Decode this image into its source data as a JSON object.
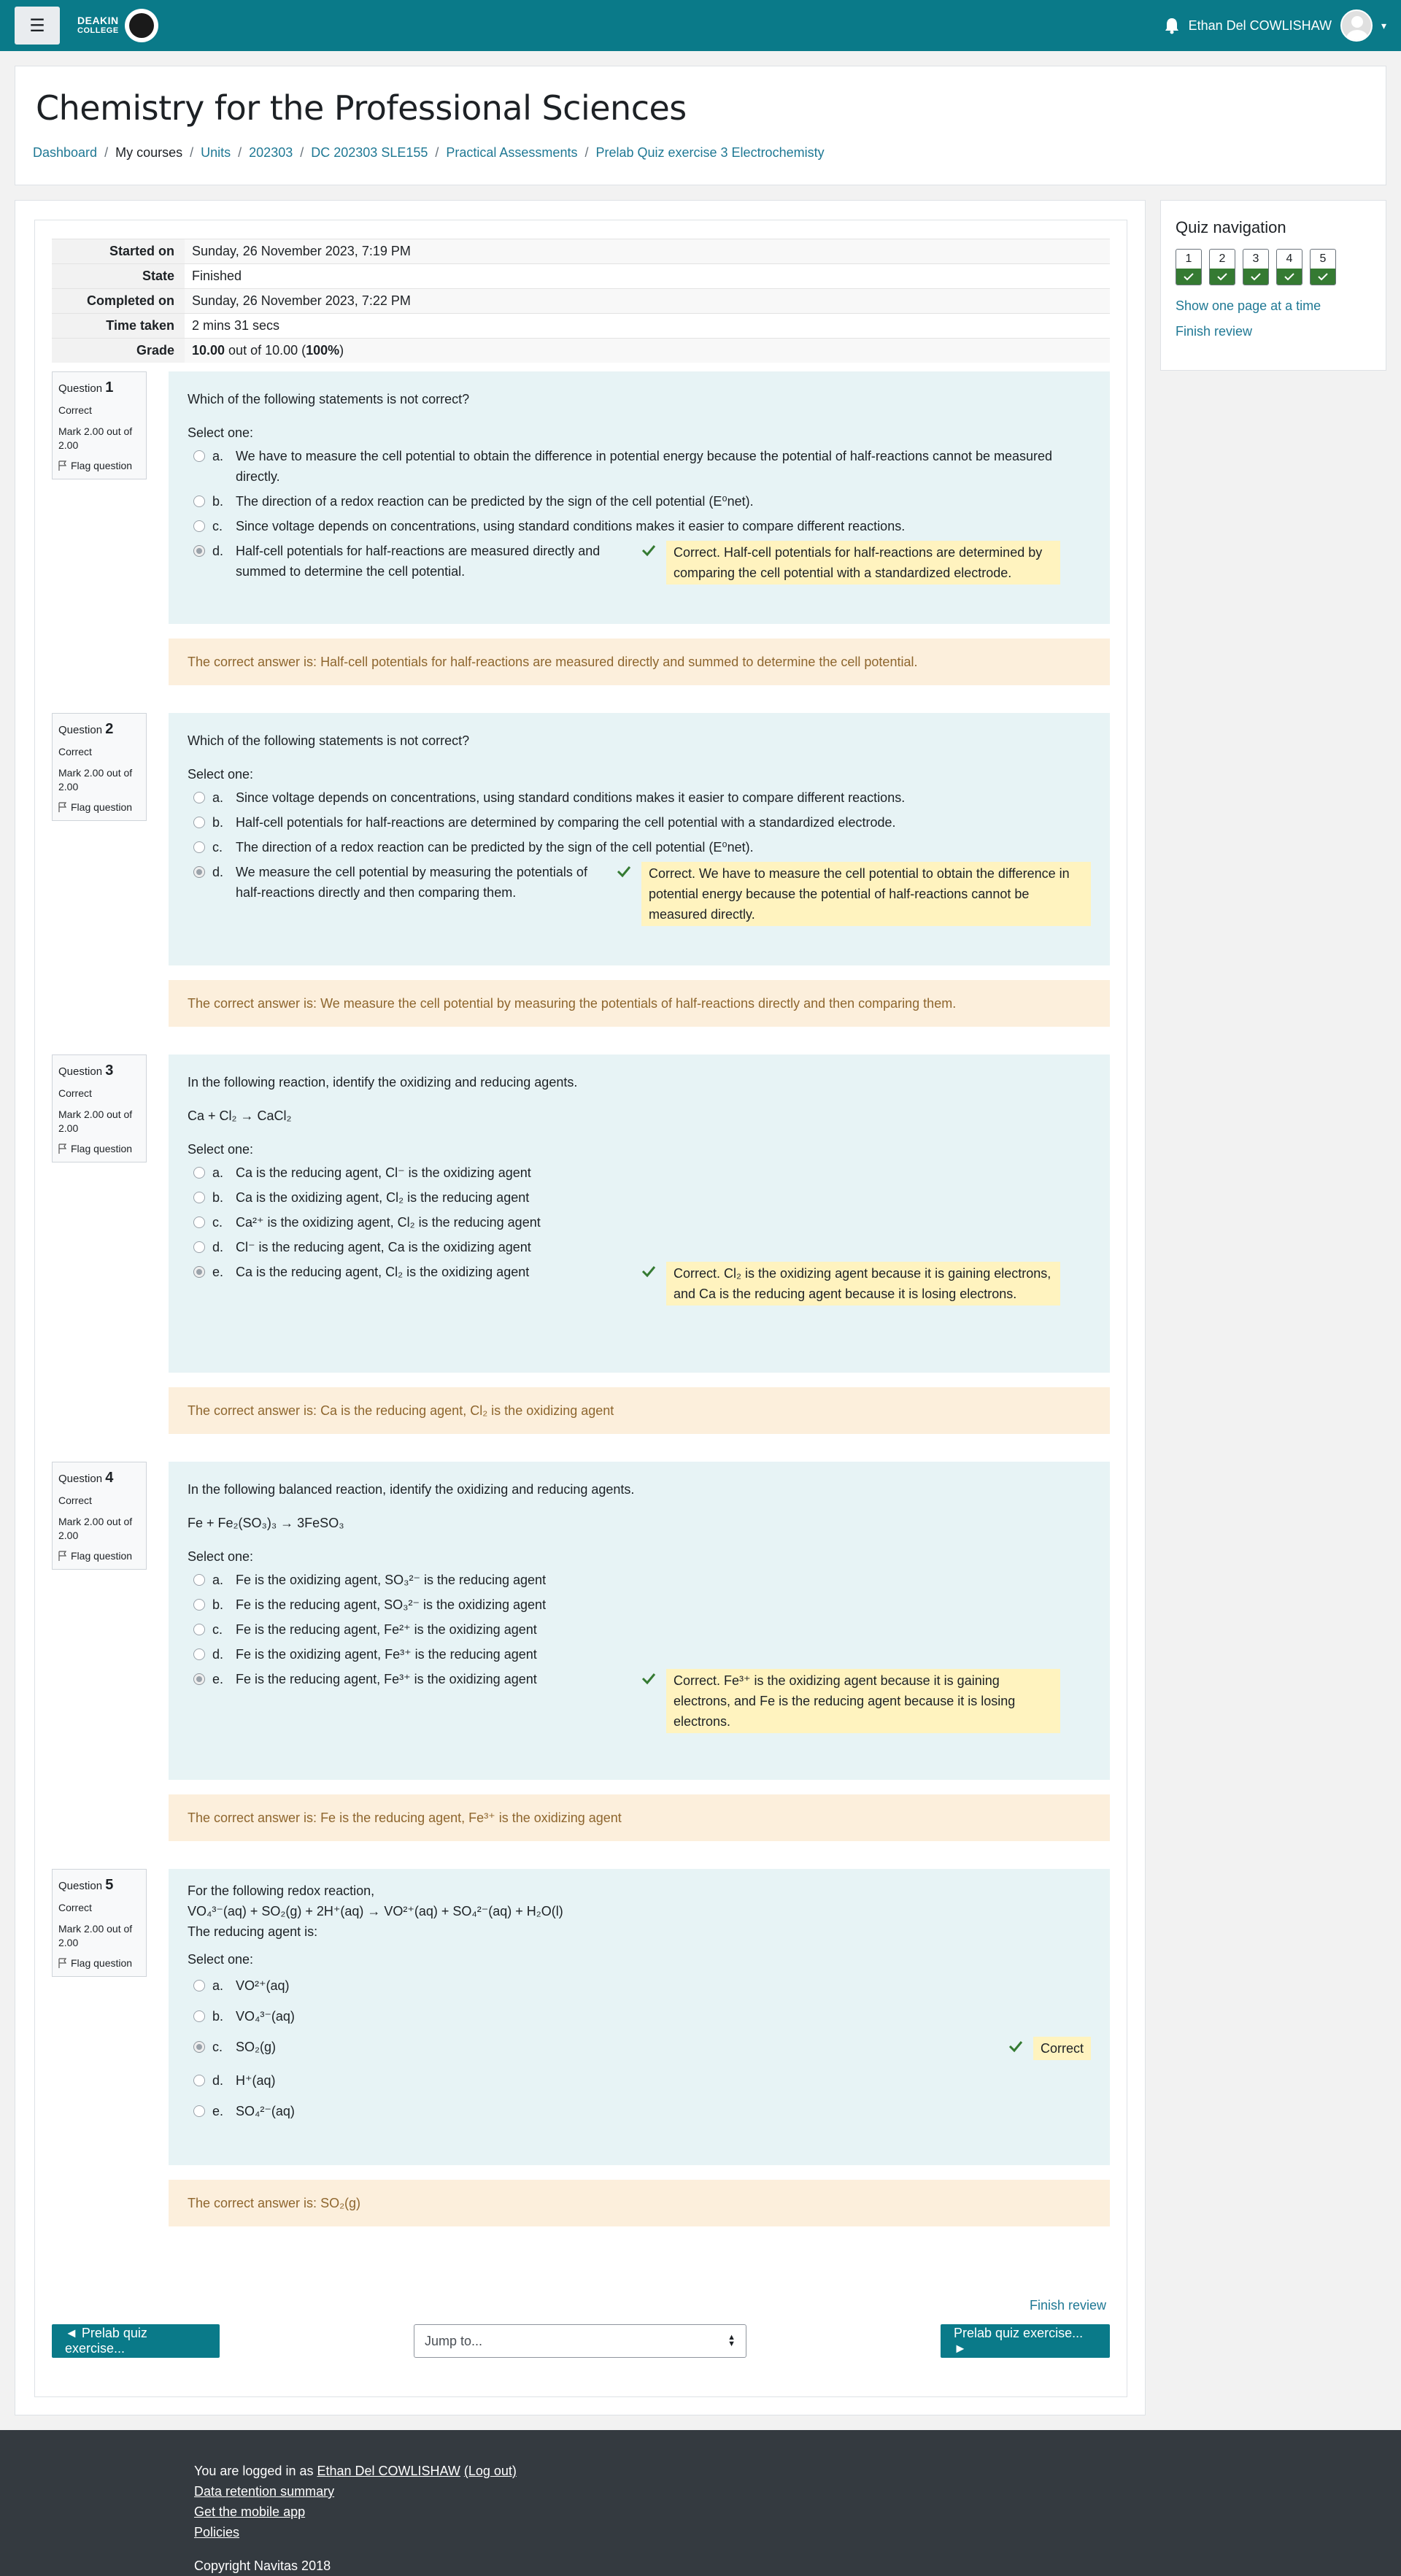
{
  "navbar": {
    "logo_text_line1": "DEAKIN",
    "logo_text_line2": "COLLEGE",
    "user_name": "Ethan Del COWLISHAW",
    "caret": "▾",
    "menu_icon": "☰"
  },
  "header": {
    "title": "Chemistry for the Professional Sciences",
    "breadcrumb": [
      "Dashboard",
      "My courses",
      "Units",
      "202303",
      "DC 202303 SLE155",
      "Practical Assessments",
      "Prelab Quiz exercise 3 Electrochemisty"
    ]
  },
  "summary": {
    "started_label": "Started on",
    "started": "Sunday, 26 November 2023, 7:19 PM",
    "state_label": "State",
    "state": "Finished",
    "completed_label": "Completed on",
    "completed": "Sunday, 26 November 2023, 7:22 PM",
    "time_label": "Time taken",
    "time": "2 mins 31 secs",
    "grade_label": "Grade",
    "grade_score": "10.00",
    "grade_mid": " out of 10.00 (",
    "grade_pct": "100%",
    "grade_end": ")"
  },
  "question_common": {
    "question_word": "Question",
    "status": "Correct",
    "mark": "Mark 2.00 out of 2.00",
    "flag": "Flag question",
    "select_one": "Select one:",
    "correct_answer_prefix": "The correct answer is: "
  },
  "questions": [
    {
      "number": "1"
    },
    {
      "number": "2"
    },
    {
      "number": "3"
    },
    {
      "number": "4"
    },
    {
      "number": "5"
    }
  ],
  "q1": {
    "text": "Which of the following statements is not correct?",
    "options": [
      {
        "letter": "a.",
        "text": "We have to measure the cell potential to obtain the difference in potential energy because the potential of half-reactions cannot be measured directly."
      },
      {
        "letter": "b.",
        "text": "The direction of a redox reaction can be predicted by the sign of the cell potential (E⁰net)."
      },
      {
        "letter": "c.",
        "text": "Since voltage depends on concentrations, using standard conditions makes it easier to compare different reactions."
      },
      {
        "letter": "d.",
        "text": "Half-cell potentials for half-reactions are measured directly and summed to determine the cell potential."
      }
    ],
    "feedback": "Correct. Half-cell potentials for half-reactions are determined by comparing the cell potential with a standardized electrode.",
    "right_answer": "Half-cell potentials for half-reactions are measured directly and summed to determine the cell potential."
  },
  "q2": {
    "text": "Which of the following statements is not correct?",
    "options": [
      {
        "letter": "a.",
        "text": "Since voltage depends on concentrations, using standard conditions makes it easier to compare different reactions."
      },
      {
        "letter": "b.",
        "text": "Half-cell potentials for half-reactions are determined by comparing the cell potential with a standardized electrode."
      },
      {
        "letter": "c.",
        "text": "The direction of a redox reaction can be predicted by the sign of the cell potential (E⁰net)."
      },
      {
        "letter": "d.",
        "text": "We measure the cell potential by measuring the potentials of half-reactions directly and then comparing them."
      }
    ],
    "feedback": "Correct. We have to measure the cell potential to obtain the difference in potential energy because the potential of half-reactions cannot be measured directly.",
    "right_answer": "We measure the cell potential by measuring the potentials of half-reactions directly and then comparing them."
  },
  "q3": {
    "text": "In the following reaction, identify the oxidizing and reducing agents.",
    "reaction": "Ca + Cl₂ → CaCl₂",
    "options": [
      {
        "letter": "a.",
        "text": "Ca is the reducing agent, Cl⁻ is the oxidizing agent"
      },
      {
        "letter": "b.",
        "text": "Ca is the oxidizing agent, Cl₂ is the reducing agent"
      },
      {
        "letter": "c.",
        "text": "Ca²⁺ is the oxidizing agent, Cl₂ is the reducing agent"
      },
      {
        "letter": "d.",
        "text": "Cl⁻ is the reducing agent, Ca is the oxidizing agent"
      },
      {
        "letter": "e.",
        "text": "Ca is the reducing agent, Cl₂ is the oxidizing agent"
      }
    ],
    "feedback": "Correct. Cl₂ is the oxidizing agent because it is gaining electrons, and Ca is the reducing agent because it is losing electrons.",
    "right_answer": "Ca is the reducing agent, Cl₂ is the oxidizing agent"
  },
  "q4": {
    "text": "In the following balanced reaction, identify the oxidizing and reducing agents.",
    "reaction": "Fe + Fe₂(SO₃)₃ → 3FeSO₃",
    "options": [
      {
        "letter": "a.",
        "text": "Fe is the oxidizing agent, SO₃²⁻ is the reducing agent"
      },
      {
        "letter": "b.",
        "text": "Fe is the reducing agent, SO₃²⁻ is the oxidizing agent"
      },
      {
        "letter": "c.",
        "text": "Fe is the reducing agent, Fe²⁺ is the oxidizing agent"
      },
      {
        "letter": "d.",
        "text": "Fe is the oxidizing agent, Fe³⁺ is the reducing agent"
      },
      {
        "letter": "e.",
        "text": "Fe is the reducing agent, Fe³⁺ is the oxidizing agent"
      }
    ],
    "feedback": "Correct. Fe³⁺ is the oxidizing agent because it is gaining electrons, and Fe is the reducing agent because it is losing electrons.",
    "right_answer": "Fe is the reducing agent, Fe³⁺ is the oxidizing agent"
  },
  "q5": {
    "text_line1": "For the following redox reaction,",
    "reaction": "VO₄³⁻(aq) + SO₂(g) + 2H⁺(aq) → VO²⁺(aq) + SO₄²⁻(aq) + H₂O(l)",
    "text_line3": "The reducing agent is:",
    "options": [
      {
        "letter": "a.",
        "text": "VO²⁺(aq)"
      },
      {
        "letter": "b.",
        "text": "VO₄³⁻(aq)"
      },
      {
        "letter": "c.",
        "text": "SO₂(g)"
      },
      {
        "letter": "d.",
        "text": "H⁺(aq)"
      },
      {
        "letter": "e.",
        "text": "SO₄²⁻(aq)"
      }
    ],
    "feedback": "Correct",
    "right_answer": "SO₂(g)"
  },
  "bottom_nav": {
    "finish_review": "Finish review",
    "prev_label": "◄ Prelab quiz exercise...",
    "jump_placeholder": "Jump to...",
    "next_label": "Prelab quiz exercise... ►"
  },
  "quiz_nav": {
    "title": "Quiz navigation",
    "buttons": [
      "1",
      "2",
      "3",
      "4",
      "5"
    ],
    "show_one_page": "Show one page at a time",
    "finish_review": "Finish review"
  },
  "footer": {
    "logged_in_prefix": "You are logged in as ",
    "user_name": "Ethan Del COWLISHAW",
    "logout": "(Log out)",
    "data_retention": "Data retention summary",
    "mobile_app": "Get the mobile app",
    "policies": "Policies",
    "copyright": "Copyright Navitas 2018"
  },
  "colors": {
    "brand": "#0a7a89",
    "link": "#1f7894",
    "correct_green": "#357a32",
    "question_bg": "#e7f3f5",
    "feedback_bg": "#fff3bf",
    "outcome_bg": "#fcefdc",
    "footer_bg": "#343a40"
  }
}
